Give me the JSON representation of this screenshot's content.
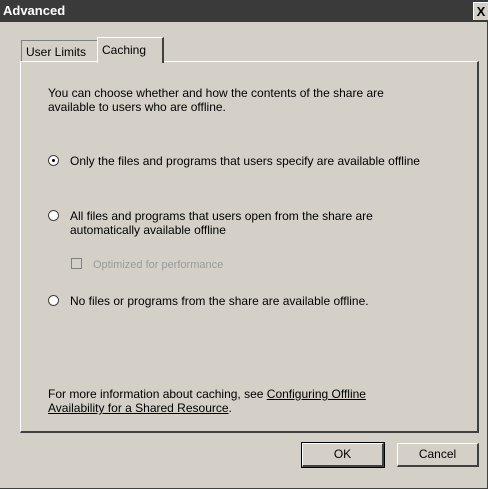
{
  "window": {
    "title": "Advanced",
    "close_label": "X"
  },
  "tabs": [
    {
      "label": "User Limits",
      "active": false
    },
    {
      "label": "Caching",
      "active": true
    }
  ],
  "caching": {
    "intro_line1": "You can choose whether and how the contents of the share are",
    "intro_line2": "available to users who are offline.",
    "option1_label": "Only the files and programs that users specify are available offline",
    "option2_line1": "All files and programs that users open from the share are",
    "option2_line2": "automatically available offline",
    "optimized_label": "Optimized for performance",
    "option3_label": "No files or programs from the share are available offline.",
    "selected_option": 1,
    "more_info_text": "For more information about caching, see",
    "link_line1": "Configuring Offline",
    "link_line2": "Availability for a Shared Resource",
    "link_suffix": "."
  },
  "buttons": {
    "ok_label": "OK",
    "cancel_label": "Cancel"
  }
}
